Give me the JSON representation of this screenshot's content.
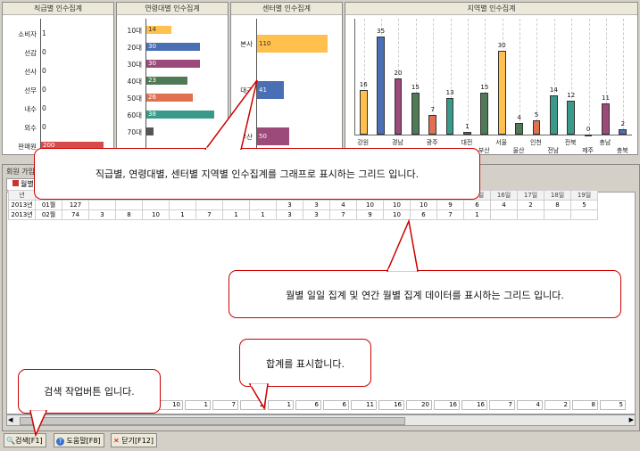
{
  "panels": {
    "job": {
      "title": "직급별 인수집계",
      "rows": [
        {
          "label": "소비자",
          "value": "1"
        },
        {
          "label": "선감",
          "value": "0"
        },
        {
          "label": "선사",
          "value": "0"
        },
        {
          "label": "선무",
          "value": "0"
        },
        {
          "label": "내수",
          "value": "0"
        },
        {
          "label": "외수",
          "value": "0"
        },
        {
          "label": "판매원",
          "value": "200"
        }
      ]
    },
    "age": {
      "title": "연령대별 인수집계",
      "rows": [
        {
          "label": "10대",
          "value": "14",
          "color": "#ffc04d"
        },
        {
          "label": "20대",
          "value": "30",
          "color": "#4a6fb5"
        },
        {
          "label": "30대",
          "value": "30",
          "color": "#9c4a7a"
        },
        {
          "label": "40대",
          "value": "23",
          "color": "#4f7a55"
        },
        {
          "label": "50대",
          "value": "26",
          "color": "#e07050"
        },
        {
          "label": "60대",
          "value": "38",
          "color": "#3a9a8a"
        },
        {
          "label": "70대",
          "value": "",
          "color": "#555555"
        }
      ]
    },
    "center": {
      "title": "센터별 인수집계",
      "rows": [
        {
          "label": "본사",
          "value": "110",
          "color": "#ffc04d"
        },
        {
          "label": "대구",
          "value": "41",
          "color": "#4a6fb5"
        },
        {
          "label": "부산",
          "value": "50",
          "color": "#9c4a7a"
        }
      ]
    },
    "region": {
      "title": "지역별 인수집계",
      "chart_data": {
        "type": "bar",
        "categories": [
          "강원",
          "경기",
          "경남",
          "경북",
          "광주",
          "대구",
          "대전",
          "부산",
          "서울",
          "울산",
          "인천",
          "전남",
          "전북",
          "제주",
          "충남",
          "충북"
        ],
        "values": [
          16,
          35,
          20,
          15,
          7,
          13,
          1,
          15,
          30,
          4,
          5,
          14,
          12,
          0,
          11,
          2
        ],
        "colors": [
          "#ffc04d",
          "#4a6fb5",
          "#9c4a7a",
          "#4f7a55",
          "#e07050",
          "#3a9a8a",
          "#9c4a7a",
          "#4f7a55",
          "#ffc04d",
          "#4f7a55",
          "#e07050",
          "#3a9a8a",
          "#3a9a8a",
          "#4a6fb5",
          "#9c4a7a",
          "#4a6fb5"
        ],
        "shown_axis_labels": [
          "강원",
          "경남",
          "광주",
          "대전",
          "부산",
          "서울",
          "울산",
          "인천",
          "전남",
          "전북",
          "제주",
          "충남",
          "충북"
        ],
        "ylim": [
          0,
          35
        ]
      }
    }
  },
  "grid": {
    "tab_title": "회원 가입인수",
    "tab_label": "월별",
    "headers": [
      "년",
      "월",
      "계",
      "1일",
      "2일",
      "3일",
      "4일",
      "5일",
      "6일",
      "7일",
      "8일",
      "9일",
      "10일",
      "11일",
      "12일",
      "13일",
      "14일",
      "15일",
      "16일",
      "17일",
      "18일",
      "19일"
    ],
    "rows": [
      [
        "2013년",
        "01월",
        "127",
        "",
        "",
        "",
        "",
        "",
        "",
        "",
        "3",
        "3",
        "4",
        "10",
        "10",
        "10",
        "9",
        "6",
        "4",
        "2",
        "8",
        "5"
      ],
      [
        "2013년",
        "02월",
        "74",
        "3",
        "8",
        "10",
        "1",
        "7",
        "1",
        "1",
        "3",
        "3",
        "7",
        "9",
        "10",
        "6",
        "7",
        "1",
        "",
        "",
        "",
        ""
      ]
    ],
    "sum_values": [
      "10",
      "1",
      "7",
      "1",
      "1",
      "6",
      "6",
      "11",
      "16",
      "20",
      "16",
      "16",
      "7",
      "4",
      "2",
      "8",
      "5"
    ]
  },
  "callouts": {
    "chart": "직급별, 연령대별, 센터별 지역별 인수집계를 그래프로 표시하는 그리드 입니다.",
    "grid": "월별 일일 집계 및 연간 월별 집계 데이터를 표시하는 그리드 입니다.",
    "sum": "합계를 표시합니다.",
    "search": "검색 작업버튼 입니다."
  },
  "buttons": {
    "search": "검색[F1]",
    "help": "도움말[F8]",
    "close": "닫기[F12]"
  }
}
